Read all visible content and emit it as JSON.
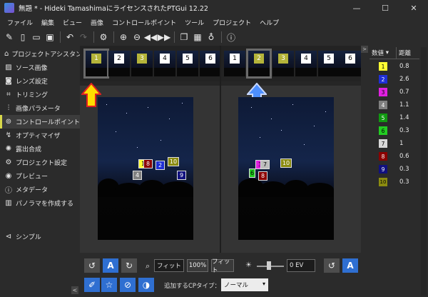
{
  "titlebar": {
    "title": "無題 * - Hideki TamashimaにライセンスされたPTGui 12.22",
    "minimize": "—",
    "maximize": "☐",
    "close": "✕"
  },
  "menu": [
    "ファイル",
    "編集",
    "ビュー",
    "画像",
    "コントロールポイント",
    "ツール",
    "プロジェクト",
    "ヘルプ"
  ],
  "sidebar": {
    "items": [
      {
        "label": "プロジェクトアシスタント",
        "icon": "home-icon"
      },
      {
        "label": "ソース画像",
        "icon": "image-icon"
      },
      {
        "label": "レンズ設定",
        "icon": "camera-icon"
      },
      {
        "label": "トリミング",
        "icon": "crop-icon"
      },
      {
        "label": "画像パラメータ",
        "icon": "sliders-icon"
      },
      {
        "label": "コントロールポイント",
        "icon": "control-points-icon"
      },
      {
        "label": "オプティマイザ",
        "icon": "optimizer-icon"
      },
      {
        "label": "露出合成",
        "icon": "sun-icon"
      },
      {
        "label": "プロジェクト設定",
        "icon": "gear-icon"
      },
      {
        "label": "プレビュー",
        "icon": "eye-icon"
      },
      {
        "label": "メタデータ",
        "icon": "info-icon"
      },
      {
        "label": "パノラマを作成する",
        "icon": "panorama-icon"
      }
    ],
    "simple_label": "シンプル",
    "collapse": "<"
  },
  "left_strip": {
    "thumbs": [
      "1",
      "2",
      "3",
      "4",
      "5",
      "6"
    ],
    "selected": "1"
  },
  "right_strip": {
    "thumbs": [
      "1",
      "2",
      "3",
      "4",
      "5",
      "6"
    ],
    "selected": "2"
  },
  "control_points": {
    "left": [
      {
        "id": "1",
        "color": "#ffff33"
      },
      {
        "id": "8",
        "color": "#8b0000"
      },
      {
        "id": "2",
        "color": "#1f2fd6"
      },
      {
        "id": "10",
        "color": "#8b8b10"
      },
      {
        "id": "4",
        "color": "#808080"
      },
      {
        "id": "9",
        "color": "#101080"
      }
    ],
    "right": [
      {
        "id": "3",
        "color": "#e020e0"
      },
      {
        "id": "7",
        "color": "#bdbdbd"
      },
      {
        "id": "10",
        "color": "#8b8b10"
      },
      {
        "id": "6",
        "color": "#22cc22"
      },
      {
        "id": "8",
        "color": "#8b0000"
      }
    ]
  },
  "bottom_toolbar": {
    "zoom_fit_left": "フィット",
    "zoom_100": "100%",
    "zoom_fit_right": "フィット",
    "auto_label": "A",
    "ev_value": "0 EV",
    "cp_type_label": "追加するCPタイプ：",
    "cp_type_value": "ノーマル"
  },
  "cp_table": {
    "col_number": "数値",
    "col_distance": "距離",
    "rows": [
      {
        "num": "1",
        "color": "#ffff33",
        "text_color": "#000000",
        "distance": "0.8"
      },
      {
        "num": "2",
        "color": "#1f2fd6",
        "text_color": "#ffffff",
        "distance": "2.6"
      },
      {
        "num": "3",
        "color": "#e020e0",
        "text_color": "#000000",
        "distance": "0.7"
      },
      {
        "num": "4",
        "color": "#808080",
        "text_color": "#ffffff",
        "distance": "1.1"
      },
      {
        "num": "5",
        "color": "#119911",
        "text_color": "#ffffff",
        "distance": "1.4"
      },
      {
        "num": "6",
        "color": "#22cc22",
        "text_color": "#000000",
        "distance": "0.3"
      },
      {
        "num": "7",
        "color": "#d8d8d8",
        "text_color": "#000000",
        "distance": "1"
      },
      {
        "num": "8",
        "color": "#8b0000",
        "text_color": "#ffffff",
        "distance": "0.6"
      },
      {
        "num": "9",
        "color": "#101080",
        "text_color": "#ffffff",
        "distance": "0.3"
      },
      {
        "num": "10",
        "color": "#8b8b10",
        "text_color": "#000000",
        "distance": "0.3"
      }
    ]
  },
  "colors": {
    "thumb_odd": "#b4b43a",
    "thumb_even": "#ffffff",
    "arrow_left": "#ffdd00",
    "arrow_right": "#4d8fff"
  }
}
